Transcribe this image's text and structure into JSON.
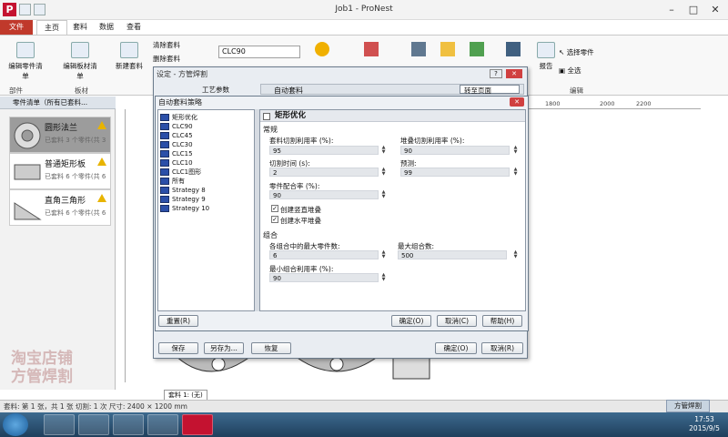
{
  "window": {
    "title": "Job1 - ProNest"
  },
  "menu": {
    "tabs": [
      "文件",
      "主页",
      "套料",
      "数据",
      "查看"
    ]
  },
  "ribbon": {
    "edit_part_list": "编辑零件清单",
    "edit_plate_list": "编辑板材清单",
    "new_nest": "新建套料",
    "clear_nest": "清除套料",
    "delete_nest": "删除套料",
    "strategy_value": "CLC90",
    "select_part": "选择零件",
    "select_all": "全选",
    "report": "报告",
    "groups": {
      "parts": "部件",
      "plate": "板材",
      "edit": "编辑"
    }
  },
  "left_panel": {
    "header": "零件清单（所有已套料...",
    "parts": [
      {
        "name": "圆形法兰",
        "sub": "已套料 3 个零件(共 3"
      },
      {
        "name": "普通矩形板",
        "sub": "已套料 6 个零件(共 6"
      },
      {
        "name": "直角三角形",
        "sub": "已套料 6 个零件(共 6"
      }
    ]
  },
  "outer_dialog": {
    "title": "设定 - 方管焊割",
    "tab_label": "工艺参数",
    "auto_nest_label": "自动套料",
    "goto_page": "转至页面",
    "buttons": {
      "save": "保存",
      "save_as": "另存为...",
      "restore": "恢复",
      "ok": "确定(O)",
      "cancel": "取消(R)"
    }
  },
  "inner_dialog": {
    "title": "自动套料策略",
    "tree": [
      "矩形优化",
      "CLC90",
      "CLC45",
      "CLC30",
      "CLC15",
      "CLC10",
      "CLC1图形",
      "所有",
      "Strategy 8",
      "Strategy 9",
      "Strategy 10"
    ],
    "panel_title": "矩形优化",
    "sections": {
      "general": "常规",
      "combine": "组合"
    },
    "fields": {
      "util": {
        "label": "套料切割利用率 (%):",
        "value": "95"
      },
      "stack_util": {
        "label": "堆叠切割利用率 (%):",
        "value": "90"
      },
      "cut_time": {
        "label": "切割时间 (s):",
        "value": "2"
      },
      "preview": {
        "label": "预测:",
        "value": "99"
      },
      "fit_util": {
        "label": "零件配合率 (%):",
        "value": "90"
      },
      "max_parts": {
        "label": "各组合中的最大零件数:",
        "value": "6"
      },
      "max_combos": {
        "label": "最大组合数:",
        "value": "500"
      },
      "min_combo_util": {
        "label": "最小组合利用率 (%):",
        "value": "90"
      }
    },
    "checks": {
      "vertical": "创建竖直堆叠",
      "horizontal": "创建水平堆叠"
    },
    "buttons": {
      "reset": "重置(R)",
      "ok": "确定(O)",
      "cancel": "取消(C)",
      "help": "帮助(H)"
    }
  },
  "ruler": {
    "marks": [
      "1800",
      "2000",
      "2200"
    ]
  },
  "sheet_tab": "套料 1: (无)",
  "status": {
    "text": "套料: 第 1 张，共 1 张    切割: 1 次    尺寸: 2400 × 1200 mm",
    "brand_button": "方管焊割"
  },
  "taskbar": {
    "time": "17:53",
    "date": "2015/9/5"
  },
  "watermark": "淘宝店铺\n方管焊割"
}
